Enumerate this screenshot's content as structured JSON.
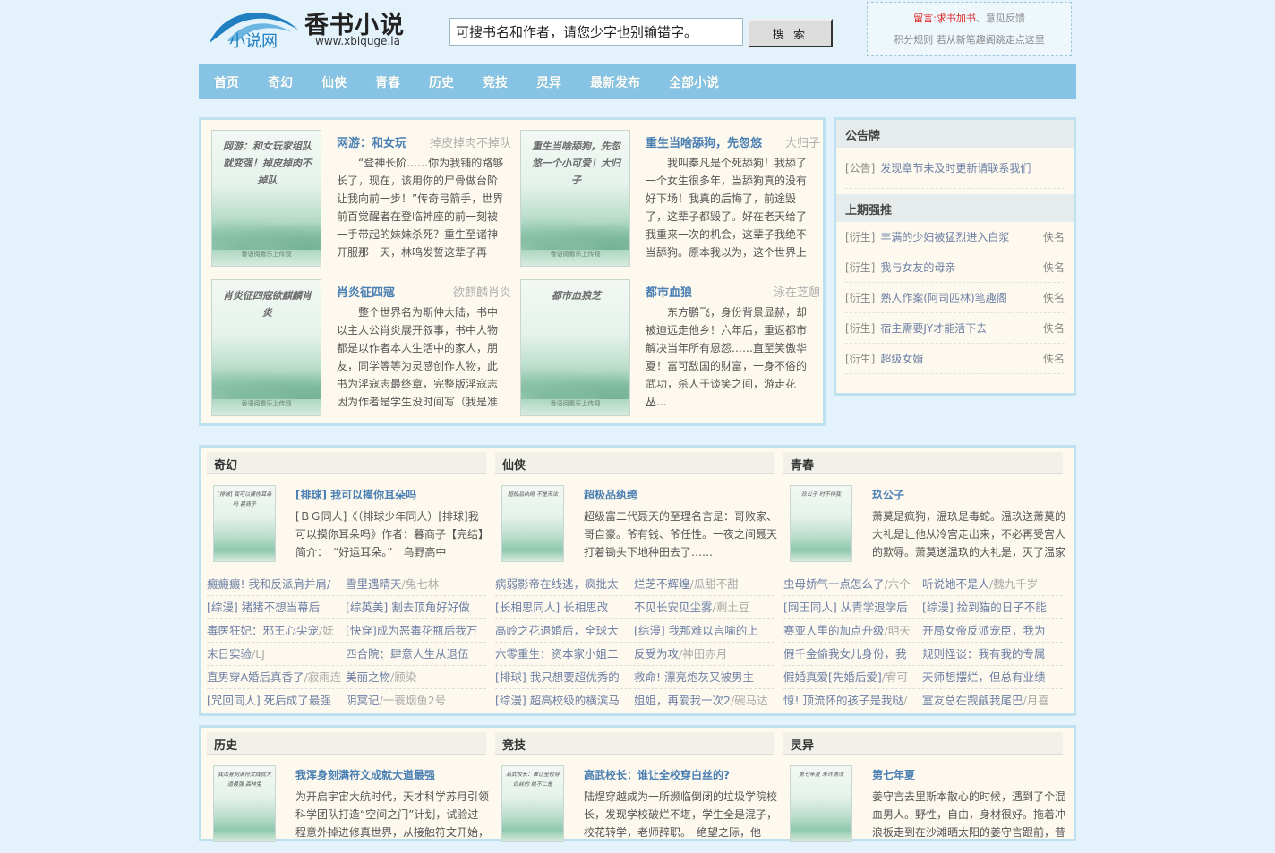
{
  "header": {
    "logo_small": "小说网",
    "logo_title": "香书小说",
    "logo_url": "www.xbiquge.la",
    "search_placeholder": "可搜书名和作者，请您少字也别输错字。",
    "search_button": "搜 索",
    "notice_label": "留言:",
    "notice_link1": "求书加书",
    "notice_sep": "、",
    "notice_link2": "意见反馈",
    "notice_line2": "积分规则 若从新笔趣阁跳走点这里"
  },
  "nav": [
    "首页",
    "奇幻",
    "仙侠",
    "青春",
    "历史",
    "竞技",
    "灵异",
    "最新发布",
    "全部小说"
  ],
  "featured": [
    {
      "title": "网游：和女玩",
      "author": "掉皮掉肉不掉队",
      "cover": "网游：和女玩家组队就变强！掉皮掉肉不掉队",
      "desc": "“登神长阶……你为我铺的路够长了，现在，该用你的尸骨做台阶让我向前一步！”传奇弓箭手，世界前百觉醒者在登临神座的前一刻被一手带起的妹妹杀死？重生至诸神开服那一天，林鸣发誓这辈子再"
    },
    {
      "title": "重生当啥舔狗，先忽悠",
      "author": "大归子",
      "cover": "重生当啥舔狗，先忽悠一个小可爱！大归子",
      "desc": "我叫秦凡是个死舔狗！我舔了一个女生很多年，当舔狗真的没有好下场！我真的后悔了，前途毁了，这辈子都毁了。好在老天给了我重来一次的机会，这辈子我绝不当舔狗。原本我以为，这个世界上"
    },
    {
      "title": "肖炎征四寇",
      "author": "欲麒麟肖炎",
      "cover": "肖炎征四寇欲麒麟肖炎",
      "desc": "整个世界名为斯仲大陆，书中以主人公肖炎展开叙事，书中人物都是以作者本人生活中的家人，朋友，同学等等为灵感创作人物，此书为淫寇志最终章，完整版淫寇志因为作者是学生没时间写（我是准"
    },
    {
      "title": "都市血狼",
      "author": "泳在芝憩",
      "cover": "都市血狼芝",
      "desc": "东方鹏飞，身份背景显赫，却被迫远走他乡！六年后，重返都市解决当年所有恩怨……直至笑傲华夏！富可敌国的财富，一身不俗的武功，杀人于谈笑之间，游走花丛..."
    }
  ],
  "cover_footer": "香语阅看乐上传观",
  "sidebar": {
    "notice_head": "公告牌",
    "notice": {
      "tag": "[公告]",
      "text": "发现章节未及时更新请联系我们"
    },
    "top_head": "上期强推",
    "top": [
      {
        "tag": "[衍生]",
        "name": "丰满的少妇被猛烈进入白浆",
        "author": "佚名"
      },
      {
        "tag": "[衍生]",
        "name": "我与女友的母亲",
        "author": "佚名"
      },
      {
        "tag": "[衍生]",
        "name": "熟人作案(阿司匹林)笔趣阁",
        "author": "佚名"
      },
      {
        "tag": "[衍生]",
        "name": "宿主需要JY才能活下去",
        "author": "佚名"
      },
      {
        "tag": "[衍生]",
        "name": "超级女婿",
        "author": "佚名"
      }
    ]
  },
  "sections": [
    {
      "name": "奇幻",
      "top": {
        "title": "[排球] 我可以摸你耳朵吗",
        "cover": "[排球] 我可以摸你耳朵吗 暮商子",
        "desc": "[ＢＧ同人]《（排球少年同人）[排球]我可以摸你耳朵吗》作者：暮商子【完结】简介：　“好运耳朵。”　乌野高中"
      },
      "list": [
        [
          "癜癜癜! 我和反派肩并肩/",
          ""
        ],
        [
          "雪里遇晴天",
          "/兔七林"
        ],
        [
          "[综漫] 猪猪不想当幕后",
          ""
        ],
        [
          "[综英美] 割去顶角好好做",
          ""
        ],
        [
          "毒医狂妃：邪王心尖宠",
          "/妩"
        ],
        [
          "[快穿]成为恶毒花瓶后我万",
          ""
        ],
        [
          "末日实验",
          "/LJ"
        ],
        [
          "四合院：肆意人生从退伍",
          ""
        ],
        [
          "直男穿A婚后真香了",
          "/寂雨连"
        ],
        [
          "美丽之物",
          "/顾染"
        ],
        [
          "[咒回同人] 死后成了最强",
          ""
        ],
        [
          "阴冥记",
          "/一蓑烟鱼2号"
        ]
      ]
    },
    {
      "name": "仙侠",
      "top": {
        "title": "超极品纨绔",
        "cover": "超极品纨绔 不是天泫",
        "desc": "超级富二代聂天的至理名言是：哥败家、哥自豪。爷有钱、爷任性。一夜之间聂天打着锄头下地种田去了……"
      },
      "list": [
        [
          "病弱影帝在线逃，疯批太",
          ""
        ],
        [
          "烂芝不辉煌",
          "/瓜甜不甜"
        ],
        [
          "[长相思同人] 长相思改",
          ""
        ],
        [
          "不见长安见尘雾",
          "/剩土豆"
        ],
        [
          "高岭之花退婚后，全球大",
          ""
        ],
        [
          "[综漫] 我那难以言喻的上",
          ""
        ],
        [
          "六零重生：资本家小姐二",
          ""
        ],
        [
          "反受为攻",
          "/神田赤月"
        ],
        [
          "[排球] 我只想要超优秀的",
          ""
        ],
        [
          "救命! 漂亮炮灰又被男主",
          ""
        ],
        [
          "[综漫] 超高校级的横滨马",
          ""
        ],
        [
          "姐姐，再爱我一次2",
          "/碗马达"
        ]
      ]
    },
    {
      "name": "青春",
      "top": {
        "title": "玖公子",
        "cover": "玖公子 时不待我",
        "desc": "萧莫是疯狗，温玖是毒蛇。温玖送萧莫的大礼是让他从冷宫走出来，不必再受宫人的欺辱。萧莫送温玖的大礼是，灭了温家"
      },
      "list": [
        [
          "虫母娇气一点怎么了",
          "/六个"
        ],
        [
          "听说她不是人",
          "/魏九千岁"
        ],
        [
          "[网王同人] 从青学退学后",
          ""
        ],
        [
          "[综漫] 捡到猫的日子不能",
          ""
        ],
        [
          "赛亚人里的加点升级",
          "/明天"
        ],
        [
          "开局女帝反派宠臣，我为",
          ""
        ],
        [
          "假千金偷我女儿身份，我",
          ""
        ],
        [
          "规则怪谈：我有我的专属",
          ""
        ],
        [
          "假婚真爱[先婚后爱]",
          "/宥可"
        ],
        [
          "天师想摆烂，但总有业绩",
          ""
        ],
        [
          "惊! 顶流怀的孩子是我哒",
          "/"
        ],
        [
          "室友总在觊觎我尾巴",
          "/月喜"
        ]
      ]
    },
    {
      "name": "历史",
      "top": {
        "title": "我浑身刻满符文成就大道最强",
        "cover": "我浑身刻满符文成就大道最强 森林兔",
        "desc": "为开启宇宙大航时代，天才科学苏月引领科学团队打造“空间之门”计划，试验过程意外掉进修真世界，从接触符文开始，"
      }
    },
    {
      "name": "竞技",
      "top": {
        "title": "高武校长：谁让全校穿白丝的?",
        "cover": "高武校长：谁让全校穿白丝的 绝不二是",
        "desc": "陆煜穿越成为一所濒临倒闭的垃圾学院校长，发现学校破烂不堪，学生全是混子，校花转学，老师辞职。　绝望之际，他"
      }
    },
    {
      "name": "灵异",
      "top": {
        "title": "第七年夏",
        "cover": "第七年夏 未许清浅",
        "desc": "姜守言去里斯本散心的时候，遇到了个混血男人。野性，自由，身材很好。拖着冲浪板走到在沙滩晒太阳的姜守言跟前，昔"
      }
    }
  ]
}
